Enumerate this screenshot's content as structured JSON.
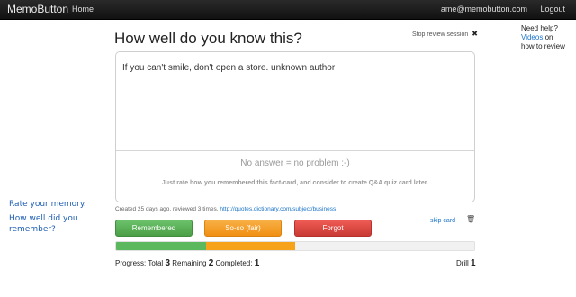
{
  "navbar": {
    "brand": "MemoButton",
    "home": "Home",
    "email": "ame@memobutton.com",
    "logout": "Logout"
  },
  "help": {
    "line1": "Need help?",
    "videos": "Videos",
    "on": "on",
    "line3": "how to review"
  },
  "side_note": {
    "rate": "Rate your memory.",
    "how": "How well did you remember?"
  },
  "page": {
    "title": "How well do you know this?",
    "stop": "Stop review session"
  },
  "card": {
    "question": "If you can't smile, don't open a store. unknown author",
    "no_answer": "No answer = no problem :-)",
    "hint": "Just rate how you remembered this fact-card, and consider to create Q&A quiz card later."
  },
  "meta": {
    "text": "Created 25 days ago, reviewed 3 times,",
    "link": "http://quotes.dictionary.com/subject/business"
  },
  "buttons": {
    "remembered": "Remembered",
    "soso": "So-so (fair)",
    "forgot": "Forgot",
    "skip": "skip card"
  },
  "progress_bar": {
    "remembered_fraction": 0.25,
    "soso_fraction": 0.25,
    "colors": {
      "remembered": "#5cb85c",
      "soso": "#f7a21b"
    }
  },
  "progress": {
    "label": "Progress:",
    "total_label": "Total",
    "total": "3",
    "remaining_label": "Remaining",
    "remaining": "2",
    "completed_label": "Completed:",
    "completed": "1",
    "drill_label": "Drill",
    "drill": "1"
  },
  "icons": {
    "stop": "close-icon",
    "trash": "trash-icon"
  }
}
